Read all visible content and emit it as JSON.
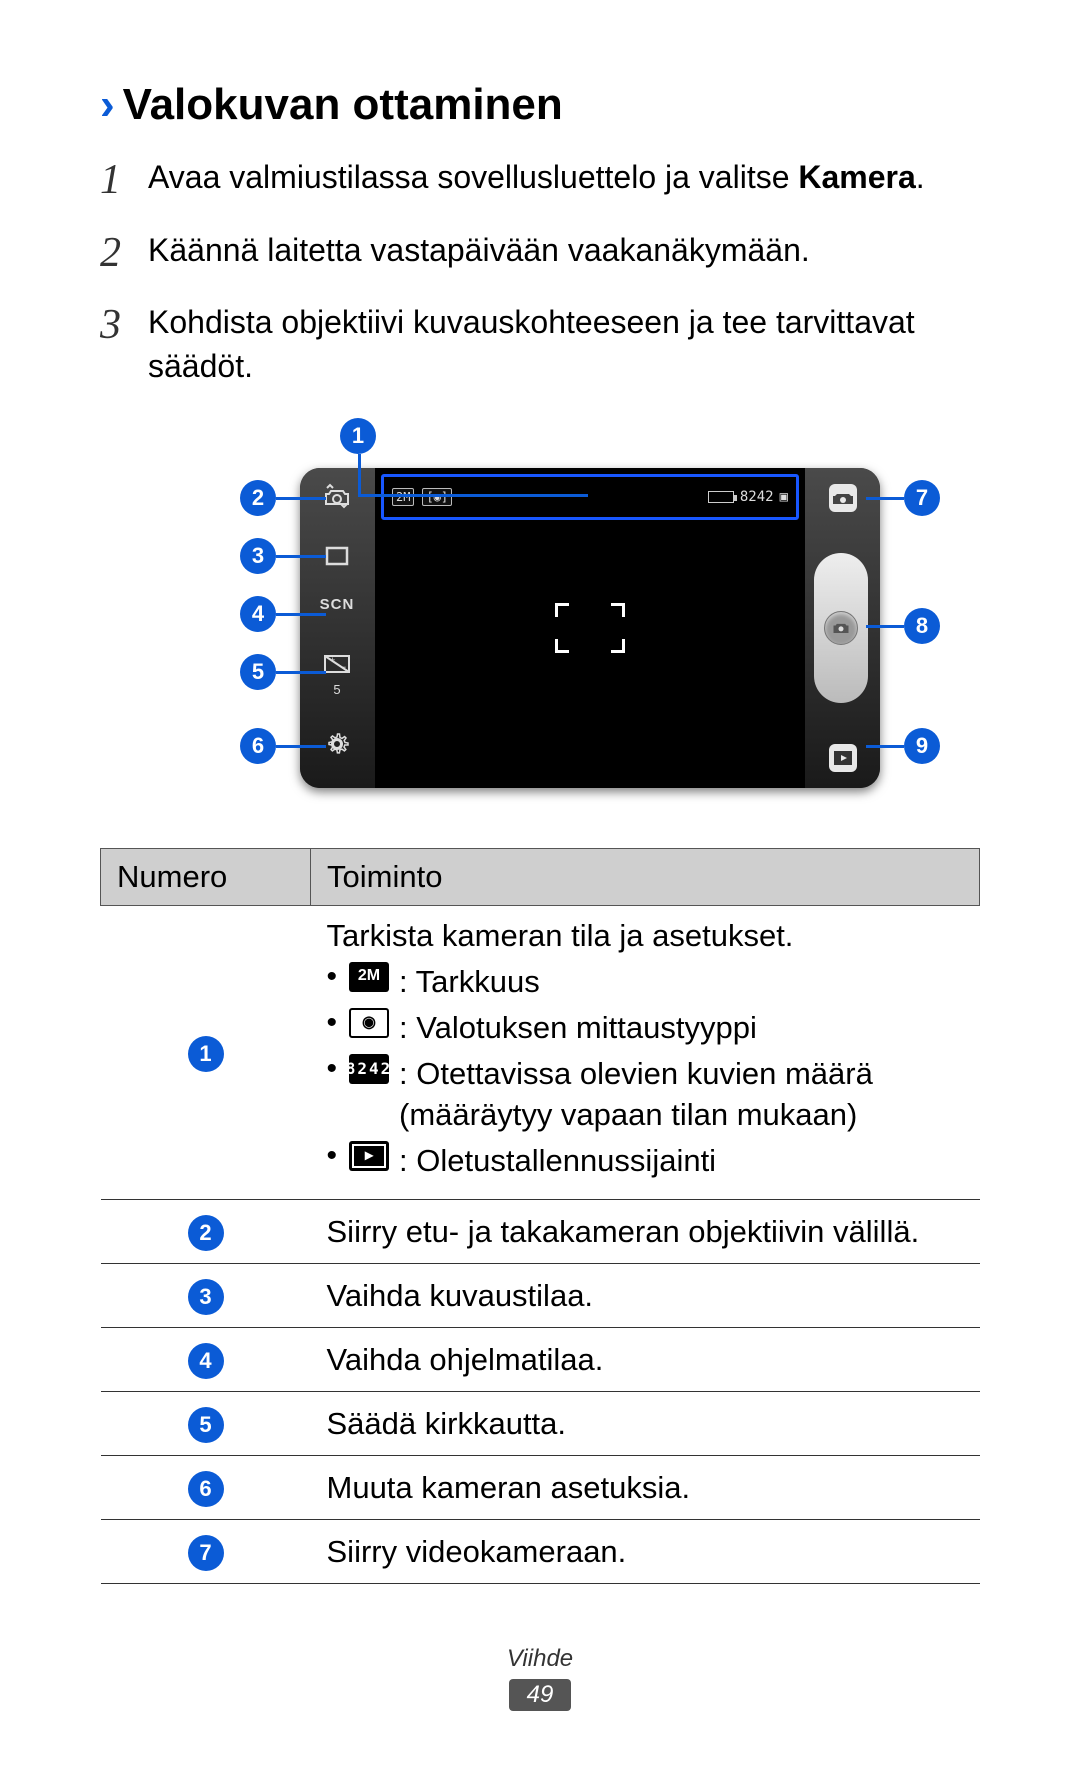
{
  "heading": {
    "chevron": "›",
    "title": "Valokuvan ottaminen"
  },
  "steps": {
    "s1": {
      "num": "1",
      "text_a": "Avaa valmiustilassa sovellusluettelo ja valitse ",
      "bold": "Kamera",
      "text_b": "."
    },
    "s2": {
      "num": "2",
      "text": "Käännä laitetta vastapäivään vaakanäkymään."
    },
    "s3": {
      "num": "3",
      "text": "Kohdista objektiivi kuvauskohteeseen ja tee tarvittavat säädöt."
    }
  },
  "diagram": {
    "status": {
      "res": "2M",
      "meter": "[◉]",
      "count": "8242",
      "scn": "SCN",
      "ev_label": "5"
    }
  },
  "callouts": [
    "1",
    "2",
    "3",
    "4",
    "5",
    "6",
    "7",
    "8",
    "9"
  ],
  "table": {
    "h1": "Numero",
    "h2": "Toiminto",
    "rows": {
      "r1": {
        "badge": "1",
        "lead": "Tarkista kameran tila ja asetukset.",
        "b1_label": "2M",
        "b1_text": " : Tarkkuus",
        "b2_text": " : Valotuksen mittaustyyppi",
        "b3_label": "8242",
        "b3_text": " : Otettavissa olevien kuvien määrä (määräytyy vapaan tilan mukaan)",
        "b4_text": " : Oletustallennussijainti"
      },
      "r2": {
        "badge": "2",
        "text": "Siirry etu- ja takakameran objektiivin välillä."
      },
      "r3": {
        "badge": "3",
        "text": "Vaihda kuvaustilaa."
      },
      "r4": {
        "badge": "4",
        "text": "Vaihda ohjelmatilaa."
      },
      "r5": {
        "badge": "5",
        "text": "Säädä kirkkautta."
      },
      "r6": {
        "badge": "6",
        "text": "Muuta kameran asetuksia."
      },
      "r7": {
        "badge": "7",
        "text": "Siirry videokameraan."
      }
    }
  },
  "footer": {
    "section": "Viihde",
    "page": "49"
  }
}
